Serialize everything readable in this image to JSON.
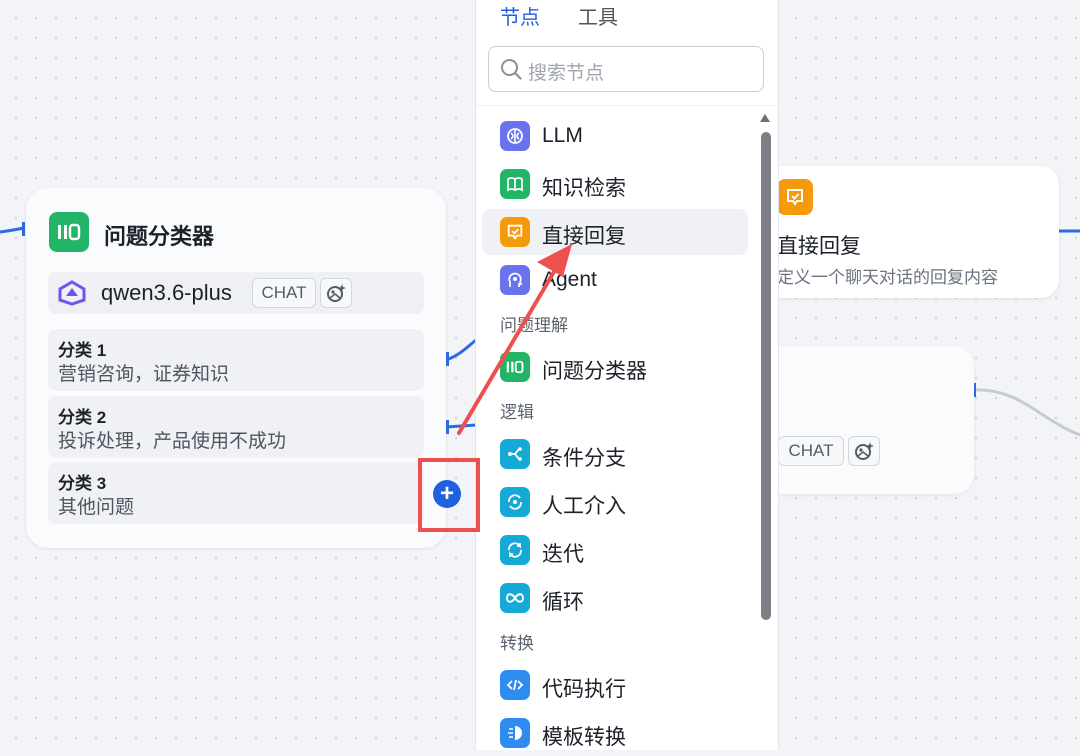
{
  "colors": {
    "accent_blue": "#1f5fe0",
    "edge_blue": "#2f6ae6",
    "highlight_red": "#ee5050",
    "green": "#22b567",
    "orange": "#f59a0c",
    "purple": "#6b72ee",
    "cyan": "#17a9d6",
    "blue": "#2e8cf0"
  },
  "classifier_node": {
    "icon": "classifier-icon",
    "title": "问题分类器",
    "model": {
      "icon": "qwen-logo-icon",
      "name": "qwen3.6-plus",
      "badge": "CHAT",
      "vision_icon": "image-sparkle-icon"
    },
    "categories": [
      {
        "title": "分类 1",
        "desc": "营销咨询，证券知识"
      },
      {
        "title": "分类 2",
        "desc": "投诉处理，产品使用不成功"
      },
      {
        "title": "分类 3",
        "desc": "其他问题"
      }
    ],
    "add_icon": "plus-icon",
    "add_symbol": "+"
  },
  "panel": {
    "tabs": [
      {
        "label": "节点",
        "active": true
      },
      {
        "label": "工具",
        "active": false
      }
    ],
    "search_placeholder": "搜索节点",
    "items": [
      {
        "label": "LLM",
        "icon": "brain-icon",
        "color": "#6b72ee"
      },
      {
        "label": "知识检索",
        "icon": "book-icon",
        "color": "#22b567"
      },
      {
        "label": "直接回复",
        "icon": "reply-icon",
        "color": "#f59a0c"
      },
      {
        "label": "Agent",
        "icon": "agent-head-icon",
        "color": "#6b72ee"
      }
    ],
    "groups": [
      {
        "label": "问题理解",
        "items": [
          {
            "label": "问题分类器",
            "icon": "classifier-icon",
            "color": "#22b567"
          }
        ]
      },
      {
        "label": "逻辑",
        "items": [
          {
            "label": "条件分支",
            "icon": "branch-icon",
            "color": "#17a9d6"
          },
          {
            "label": "人工介入",
            "icon": "human-icon",
            "color": "#17a9d6"
          },
          {
            "label": "迭代",
            "icon": "iterate-icon",
            "color": "#17a9d6"
          },
          {
            "label": "循环",
            "icon": "infinity-icon",
            "color": "#17a9d6"
          }
        ]
      },
      {
        "label": "转换",
        "items": [
          {
            "label": "代码执行",
            "icon": "code-icon",
            "color": "#2e8cf0"
          },
          {
            "label": "模板转换",
            "icon": "template-icon",
            "color": "#2e8cf0"
          }
        ]
      }
    ]
  },
  "reply_node": {
    "icon": "reply-icon",
    "title": "直接回复",
    "desc": "定义一个聊天对话的回复内容"
  },
  "partial_node": {
    "badge": "CHAT",
    "vision_icon": "image-sparkle-icon"
  }
}
